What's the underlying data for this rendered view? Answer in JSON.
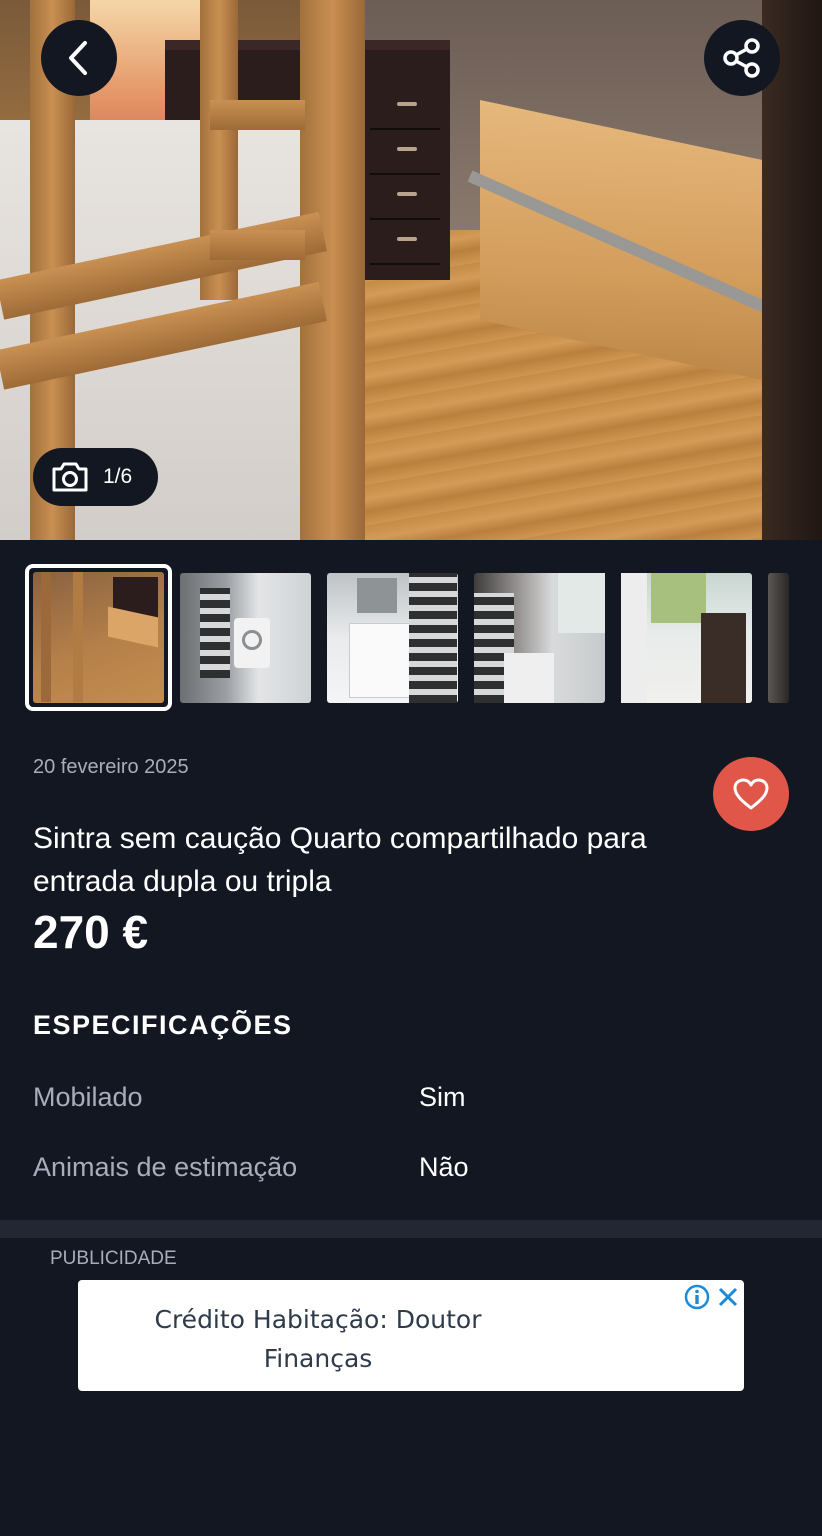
{
  "gallery": {
    "counter": "1/6",
    "back_icon": "chevron-left-icon",
    "share_icon": "share-icon",
    "camera_icon": "camera-icon"
  },
  "listing": {
    "date": "20 fevereiro 2025",
    "title": "Sintra sem caução Quarto compartilhado para entrada dupla ou tripla",
    "price": "270 €",
    "favorite_icon": "heart-icon"
  },
  "specs": {
    "heading": "ESPECIFICAÇÕES",
    "rows": [
      {
        "key": "Mobilado",
        "value": "Sim"
      },
      {
        "key": "Animais de estimação",
        "value": "Não"
      }
    ]
  },
  "ad": {
    "label": "PUBLICIDADE",
    "text": "Crédito Habitação: Doutor Finanças",
    "info_icon": "info-icon",
    "close_icon": "close-icon"
  },
  "colors": {
    "background": "#131722",
    "favorite": "#e0574a",
    "muted_text": "#a7adbb"
  }
}
